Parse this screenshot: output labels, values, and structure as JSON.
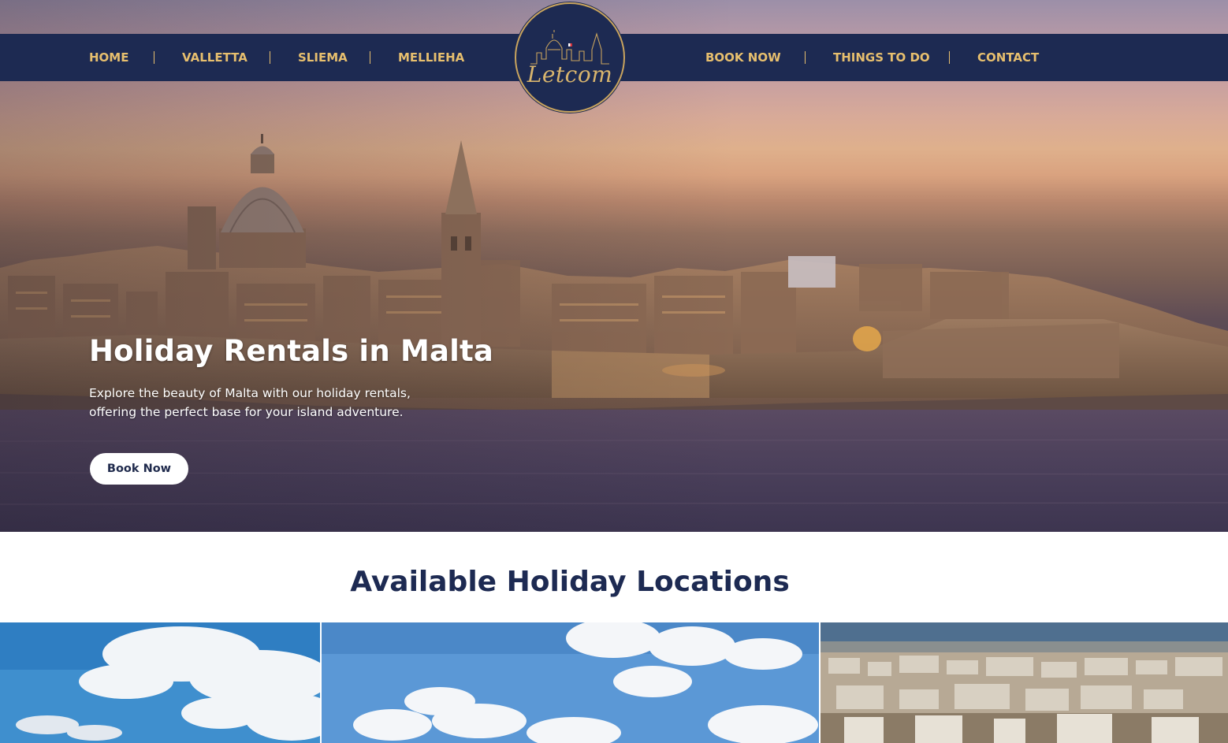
{
  "nav": {
    "left": [
      "HOME",
      "VALLETTA",
      "SLIEMA",
      "MELLIEHA"
    ],
    "right": [
      "BOOK NOW",
      "THINGS TO DO",
      "CONTACT"
    ]
  },
  "logo": {
    "text": "Letcom"
  },
  "hero": {
    "title": "Holiday Rentals in Malta",
    "subtitle": "Explore the beauty of Malta with our holiday rentals, offering the perfect base for your island adventure.",
    "button": "Book Now"
  },
  "locations": {
    "title": "Available Holiday Locations"
  },
  "colors": {
    "navy": "#1d2a52",
    "gold": "#e7bf6e",
    "white": "#ffffff"
  }
}
